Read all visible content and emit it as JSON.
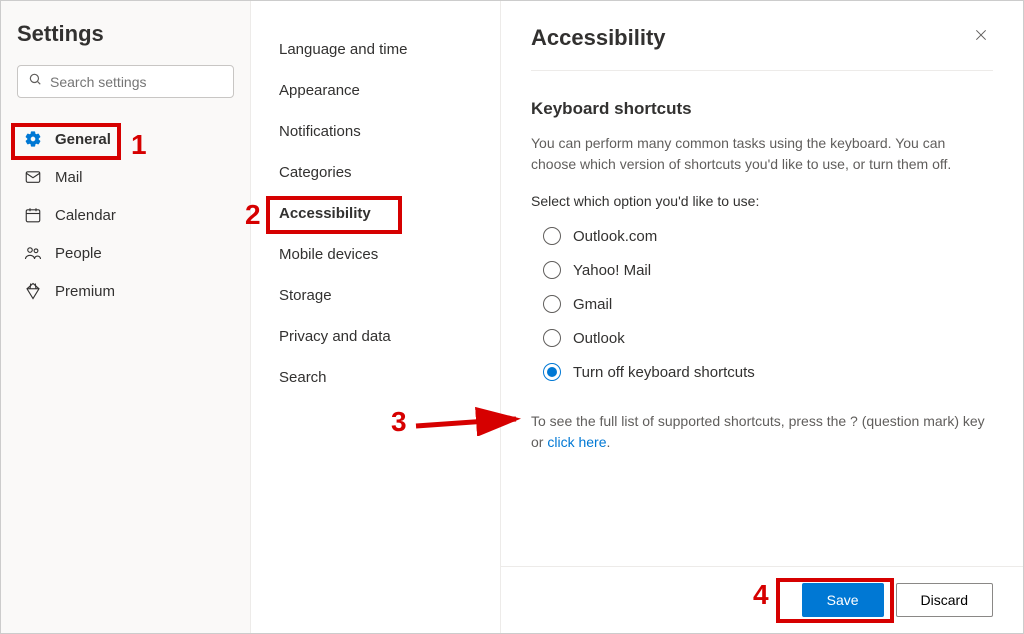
{
  "header": {
    "title": "Settings"
  },
  "search": {
    "placeholder": "Search settings"
  },
  "nav": {
    "general": "General",
    "mail": "Mail",
    "calendar": "Calendar",
    "people": "People",
    "premium": "Premium"
  },
  "mid": {
    "language": "Language and time",
    "appearance": "Appearance",
    "notifications": "Notifications",
    "categories": "Categories",
    "accessibility": "Accessibility",
    "mobile": "Mobile devices",
    "storage": "Storage",
    "privacy": "Privacy and data",
    "search": "Search"
  },
  "content": {
    "title": "Accessibility",
    "section_title": "Keyboard shortcuts",
    "desc": "You can perform many common tasks using the keyboard. You can choose which version of shortcuts you'd like to use, or turn them off.",
    "sub_label": "Select which option you'd like to use:",
    "options": {
      "outlook_com": "Outlook.com",
      "yahoo": "Yahoo! Mail",
      "gmail": "Gmail",
      "outlook": "Outlook",
      "off": "Turn off keyboard shortcuts"
    },
    "help_pre": "To see the full list of supported shortcuts, press the ? (question mark) key or ",
    "help_link": "click here",
    "help_post": "."
  },
  "footer": {
    "save": "Save",
    "discard": "Discard"
  },
  "annotations": {
    "n1": "1",
    "n2": "2",
    "n3": "3",
    "n4": "4"
  }
}
